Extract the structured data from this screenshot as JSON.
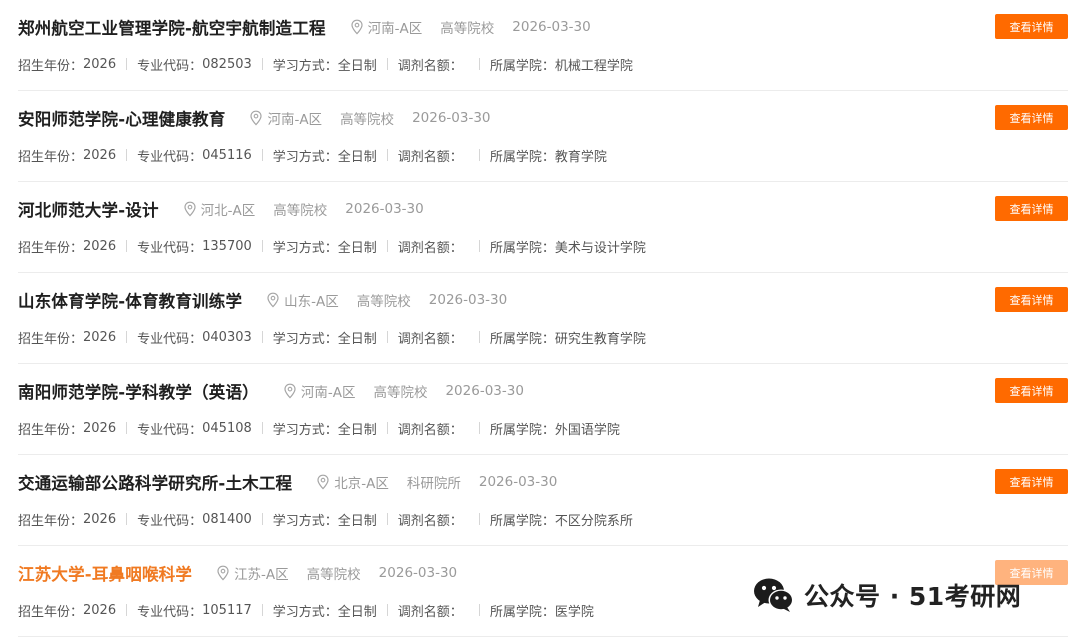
{
  "labels": {
    "year": "招生年份：",
    "code": "专业代码：",
    "mode": "学习方式：",
    "quota": "调剂名额：",
    "college": "所属学院："
  },
  "button_label": "查看详情",
  "icons": {
    "location": "location-pin-icon",
    "watermark": "wechat-icon"
  },
  "colors": {
    "accent": "#ff6a00",
    "highlight_title": "#f07a22"
  },
  "items": [
    {
      "title": "郑州航空工业管理学院-航空宇航制造工程",
      "region": "河南-A区",
      "type": "高等院校",
      "date": "2026-03-30",
      "year": "2026",
      "code": "082503",
      "mode": "全日制",
      "quota": "",
      "college": "机械工程学院"
    },
    {
      "title": "安阳师范学院-心理健康教育",
      "region": "河南-A区",
      "type": "高等院校",
      "date": "2026-03-30",
      "year": "2026",
      "code": "045116",
      "mode": "全日制",
      "quota": "",
      "college": "教育学院"
    },
    {
      "title": "河北师范大学-设计",
      "region": "河北-A区",
      "type": "高等院校",
      "date": "2026-03-30",
      "year": "2026",
      "code": "135700",
      "mode": "全日制",
      "quota": "",
      "college": "美术与设计学院"
    },
    {
      "title": "山东体育学院-体育教育训练学",
      "region": "山东-A区",
      "type": "高等院校",
      "date": "2026-03-30",
      "year": "2026",
      "code": "040303",
      "mode": "全日制",
      "quota": "",
      "college": "研究生教育学院"
    },
    {
      "title": "南阳师范学院-学科教学（英语）",
      "region": "河南-A区",
      "type": "高等院校",
      "date": "2026-03-30",
      "year": "2026",
      "code": "045108",
      "mode": "全日制",
      "quota": "",
      "college": "外国语学院"
    },
    {
      "title": "交通运输部公路科学研究所-土木工程",
      "region": "北京-A区",
      "type": "科研院所",
      "date": "2026-03-30",
      "year": "2026",
      "code": "081400",
      "mode": "全日制",
      "quota": "",
      "college": "不区分院系所"
    },
    {
      "title": "江苏大学-耳鼻咽喉科学",
      "region": "江苏-A区",
      "type": "高等院校",
      "date": "2026-03-30",
      "year": "2026",
      "code": "105117",
      "mode": "全日制",
      "quota": "",
      "college": "医学院",
      "highlight": true
    }
  ],
  "watermark": {
    "text": "公众号 · 51考研网"
  }
}
